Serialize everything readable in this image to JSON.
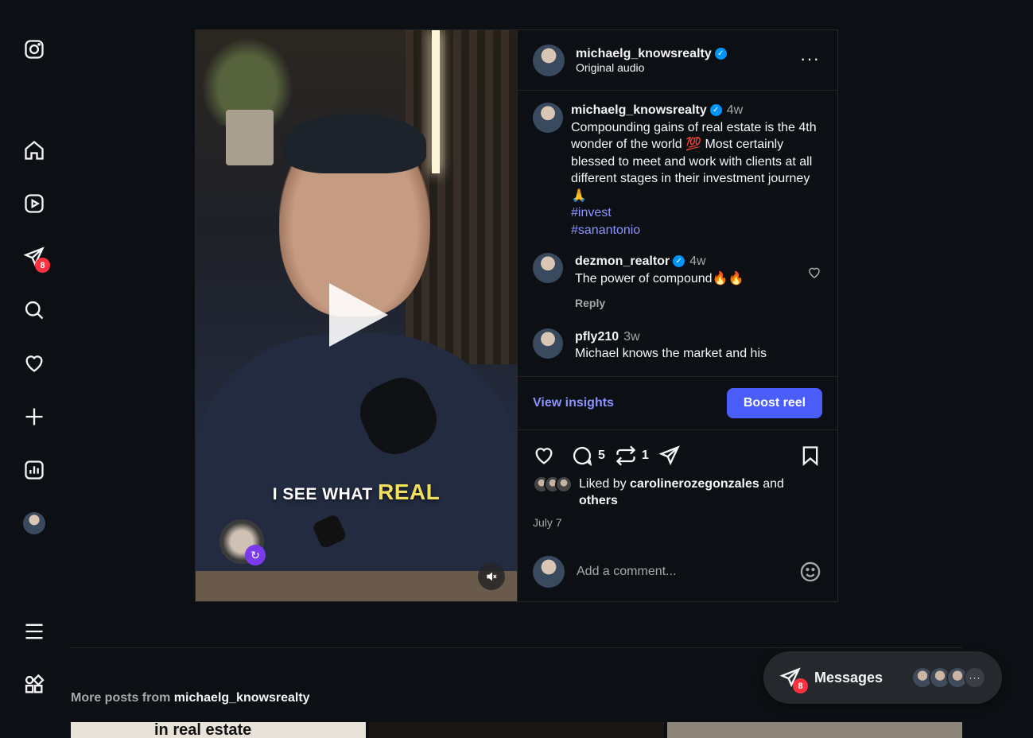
{
  "sidebar": {
    "items": [
      {
        "name": "instagram-logo-icon"
      },
      {
        "name": "home-icon"
      },
      {
        "name": "reels-icon"
      },
      {
        "name": "direct-messages-icon",
        "badge": "8"
      },
      {
        "name": "search-icon"
      },
      {
        "name": "notifications-heart-icon"
      },
      {
        "name": "create-icon"
      },
      {
        "name": "insights-icon"
      },
      {
        "name": "profile-avatar"
      },
      {
        "name": "menu-icon"
      },
      {
        "name": "more-apps-icon"
      }
    ]
  },
  "post": {
    "media": {
      "caption_text": "I SEE WHAT",
      "caption_highlight": "REAL"
    },
    "header": {
      "username": "michaelg_knowsrealty",
      "audio": "Original audio"
    },
    "caption": {
      "username": "michaelg_knowsrealty",
      "time": "4w",
      "text": "Compounding gains of real estate is the 4th wonder of the world 💯 Most certainly blessed to meet and work with clients at all different stages in their investment journey 🙏",
      "hashtags": [
        "#invest",
        "#sanantonio"
      ]
    },
    "comments": [
      {
        "username": "dezmon_realtor",
        "verified": true,
        "time": "4w",
        "text": "The power of compound🔥🔥",
        "reply": "Reply"
      },
      {
        "username": "pfly210",
        "verified": false,
        "time": "3w",
        "text": "Michael knows the market and his"
      }
    ],
    "insights": {
      "view_label": "View insights",
      "boost_label": "Boost reel"
    },
    "actions": {
      "comment_count": "5",
      "repost_count": "1"
    },
    "likes": {
      "prefix": "Liked by",
      "user": "carolinerozegonzales",
      "joiner": "and",
      "others": "others"
    },
    "date": "July 7",
    "add_comment": {
      "placeholder": "Add a comment..."
    }
  },
  "more_posts": {
    "prefix": "More posts from",
    "username": "michaelg_knowsrealty",
    "thumb_text": "in real estate"
  },
  "messages": {
    "label": "Messages",
    "badge": "8",
    "more": "···"
  },
  "colors": {
    "background": "#0c1014",
    "accent_link": "#8b93ff",
    "boost_button": "#4a5df9",
    "badge": "#ff3040",
    "verified": "#0095f6"
  }
}
